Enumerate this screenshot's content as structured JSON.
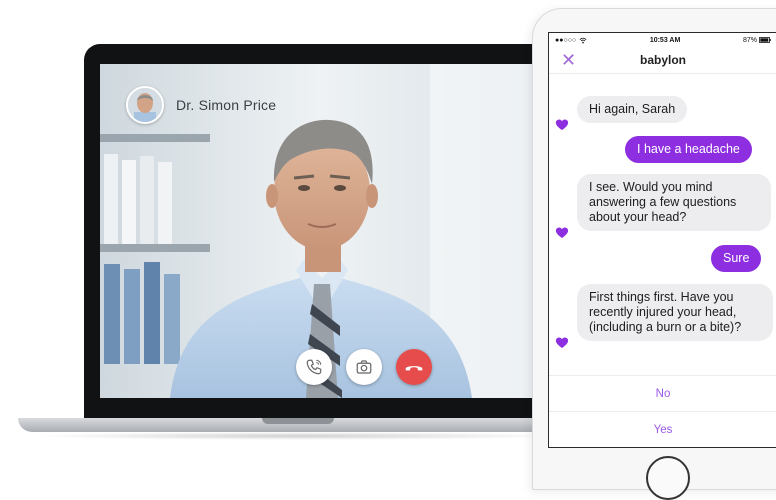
{
  "video_call": {
    "doctor_name": "Dr. Simon Price",
    "controls": [
      {
        "name": "switch-audio-button",
        "icon": "phone-icon"
      },
      {
        "name": "camera-button",
        "icon": "camera-icon"
      },
      {
        "name": "end-call-button",
        "icon": "hang-up-icon"
      }
    ],
    "colors": {
      "end_call": "#e74c4c"
    }
  },
  "phone": {
    "status_bar": {
      "carrier": "●●○○○",
      "time": "10:53 AM",
      "battery": "87%"
    },
    "header": {
      "close_icon": "close-icon",
      "title": "babylon"
    },
    "messages": [
      {
        "from": "bot",
        "text": "Hi again, Sarah"
      },
      {
        "from": "user",
        "text": "I have a headache"
      },
      {
        "from": "bot",
        "text": "I see. Would you mind answering a few questions about your head?"
      },
      {
        "from": "user",
        "text": "Sure"
      },
      {
        "from": "bot",
        "text": "First things first. Have you recently injured your head, (including a burn or a bite)?"
      }
    ],
    "options": [
      "No",
      "Yes"
    ],
    "colors": {
      "accent": "#8d2ee0",
      "option_text": "#9b59e6",
      "bot_bubble": "#ededf0"
    }
  }
}
